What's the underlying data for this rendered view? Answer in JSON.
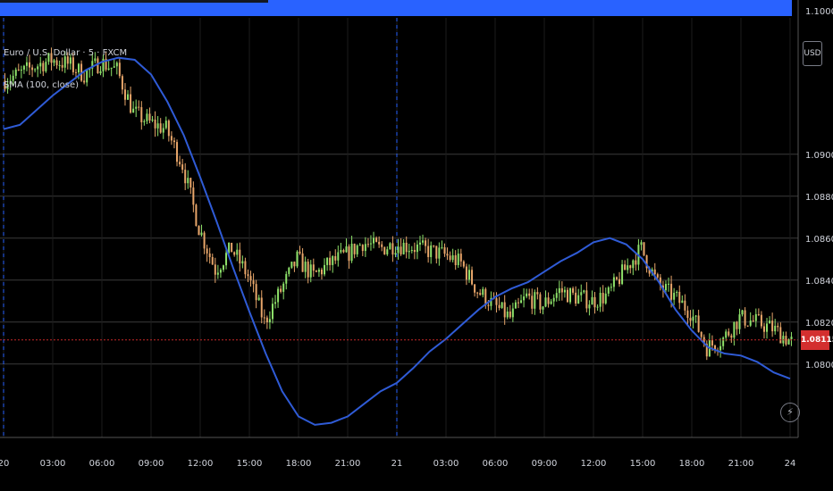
{
  "legend": {
    "symbol": "Euro / U.S. Dollar · 5 · FXCM",
    "indicator": "SMA (100, close)"
  },
  "price_axis": {
    "currency_button": "USD",
    "last_price": "1.08115",
    "top_label": "1.10000"
  },
  "colors": {
    "background": "#000000",
    "grid": "#3a3a3a",
    "sma": "#2f5bd6",
    "candle_up": "#8ee26a",
    "candle_down": "#e8a66a",
    "last_price_line": "#c62828",
    "top_bar": "#2962ff"
  },
  "icons": {
    "bolt": "lightning-icon"
  },
  "chart_data": {
    "type": "line",
    "title": "Euro / U.S. Dollar · 5 · FXCM",
    "ylim": [
      1.0765,
      1.0965
    ],
    "y_ticks": [
      "1.09000",
      "1.08800",
      "1.08600",
      "1.08400",
      "1.08200",
      "1.08000"
    ],
    "y_tick_values": [
      1.09,
      1.088,
      1.086,
      1.084,
      1.082,
      1.08
    ],
    "x_ticks": [
      "20",
      "03:00",
      "06:00",
      "09:00",
      "12:00",
      "15:00",
      "18:00",
      "21:00",
      "21",
      "03:00",
      "06:00",
      "09:00",
      "12:00",
      "15:00",
      "18:00",
      "21:00",
      "24"
    ],
    "x_tick_hours": [
      0,
      3,
      6,
      9,
      12,
      15,
      18,
      21,
      24,
      27,
      30,
      33,
      36,
      39,
      42,
      45,
      48
    ],
    "session_breaks": [
      0,
      24
    ],
    "last_price": 1.08115,
    "series": [
      {
        "name": "Euro / U.S. Dollar · 5 · FXCM",
        "hours": [
          0,
          1,
          2,
          3,
          4,
          5,
          6,
          7,
          8,
          9,
          10,
          11,
          12,
          13,
          14,
          15,
          16,
          17,
          18,
          19,
          20,
          21,
          22,
          23,
          24,
          25,
          26,
          27,
          28,
          29,
          30,
          31,
          32,
          33,
          34,
          35,
          36,
          37,
          38,
          39,
          40,
          41,
          42,
          43,
          44,
          45,
          46,
          47,
          48
        ],
        "values": [
          1.0935,
          1.0938,
          1.0942,
          1.0945,
          1.0943,
          1.0938,
          1.0944,
          1.094,
          1.092,
          1.0915,
          1.0912,
          1.0895,
          1.0865,
          1.0845,
          1.0855,
          1.0842,
          1.082,
          1.0835,
          1.085,
          1.0842,
          1.0848,
          1.0852,
          1.0858,
          1.0855,
          1.0857,
          1.0856,
          1.0854,
          1.0852,
          1.0848,
          1.0835,
          1.0828,
          1.0822,
          1.0832,
          1.0828,
          1.0835,
          1.0832,
          1.083,
          1.0833,
          1.0845,
          1.0855,
          1.0838,
          1.0832,
          1.0825,
          1.0808,
          1.0812,
          1.0822,
          1.082,
          1.0817,
          1.08115
        ]
      },
      {
        "name": "SMA (100, close)",
        "hours": [
          0,
          1,
          2,
          3,
          4,
          5,
          6,
          7,
          8,
          9,
          10,
          11,
          12,
          13,
          14,
          15,
          16,
          17,
          18,
          19,
          20,
          21,
          22,
          23,
          24,
          25,
          26,
          27,
          28,
          29,
          30,
          31,
          32,
          33,
          34,
          35,
          36,
          37,
          38,
          39,
          40,
          41,
          42,
          43,
          44,
          45,
          46,
          47,
          48
        ],
        "values": [
          1.0912,
          1.0914,
          1.0921,
          1.0928,
          1.0934,
          1.094,
          1.0944,
          1.0946,
          1.0945,
          1.0938,
          1.0925,
          1.0909,
          1.0889,
          1.0868,
          1.0846,
          1.0825,
          1.0805,
          1.0787,
          1.0775,
          1.0771,
          1.0772,
          1.0775,
          1.0781,
          1.0787,
          1.0791,
          1.0798,
          1.0806,
          1.0812,
          1.0819,
          1.0826,
          1.0832,
          1.0836,
          1.0839,
          1.0844,
          1.0849,
          1.0853,
          1.0858,
          1.086,
          1.0857,
          1.085,
          1.0839,
          1.0826,
          1.0816,
          1.0808,
          1.0805,
          1.0804,
          1.0801,
          1.0796,
          1.0793
        ]
      }
    ]
  }
}
